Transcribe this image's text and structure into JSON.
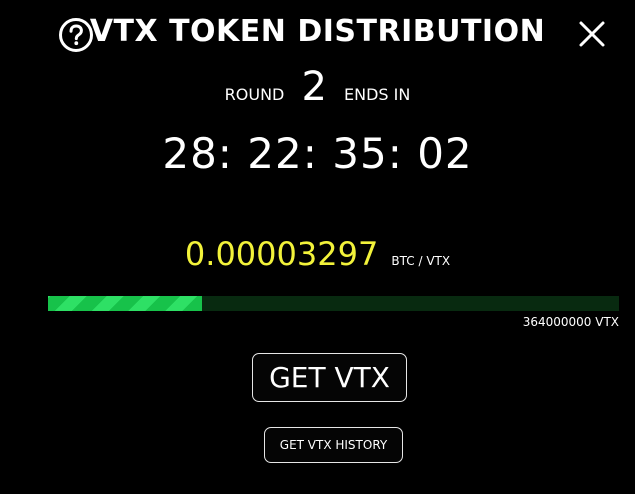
{
  "header": {
    "title": "VTX TOKEN DISTRIBUTION",
    "help_icon": "question-circle-icon",
    "close_icon": "close-x-icon"
  },
  "round": {
    "label": "ROUND",
    "number": "2",
    "ends_label": "ENDS IN"
  },
  "timer": {
    "value": "28: 22: 35: 02"
  },
  "price": {
    "value": "0.00003297",
    "unit": "BTC / VTX",
    "color": "#f2f23a"
  },
  "progress": {
    "fraction": 0.27,
    "fill_color": "#17c24a",
    "track_color": "#082a10",
    "supply_label": "364000000 VTX"
  },
  "actions": {
    "get_label": "GET VTX",
    "history_label": "GET VTX HISTORY"
  }
}
